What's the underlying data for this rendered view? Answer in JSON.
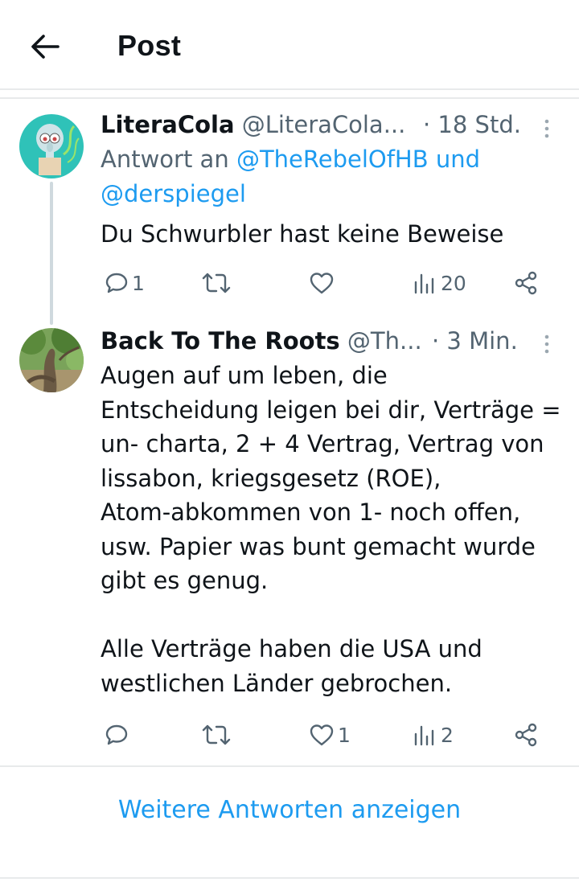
{
  "header": {
    "title": "Post",
    "back_icon": "arrow-left-icon"
  },
  "colors": {
    "link": "#1d9bf0",
    "muted": "#536471",
    "text": "#0f1419",
    "divider": "#e8eaeb"
  },
  "posts": [
    {
      "display_name": "LiteraCola",
      "handle": "@LiteraCola...",
      "time": "· 18 Std.",
      "reply_prefix": "Antwort an",
      "reply_to_line1": "@TheRebelOfHB und",
      "reply_to_line2": "@derspiegel",
      "text_lines": [
        "Du Schwurbler hast keine Beweise"
      ],
      "actions": {
        "replies": "1",
        "reposts": "",
        "likes": "",
        "views": "20"
      }
    },
    {
      "display_name": "Back To The Roots",
      "handle": "@Th...",
      "time": "· 3 Min.",
      "text_lines": [
        "Augen auf um leben, die",
        "Entscheidung leigen bei dir, Verträge =",
        "un- charta, 2 + 4 Vertrag, Vertrag von",
        "lissabon, kriegsgesetz (ROE),",
        "Atom-abkommen von 1- noch offen,",
        "usw. Papier was bunt gemacht wurde",
        "gibt es genug.",
        "",
        "Alle Verträge haben die USA und",
        "westlichen Länder gebrochen."
      ],
      "actions": {
        "replies": "",
        "reposts": "",
        "likes": "1",
        "views": "2"
      }
    }
  ],
  "footer": {
    "show_more": "Weitere Antworten anzeigen"
  }
}
